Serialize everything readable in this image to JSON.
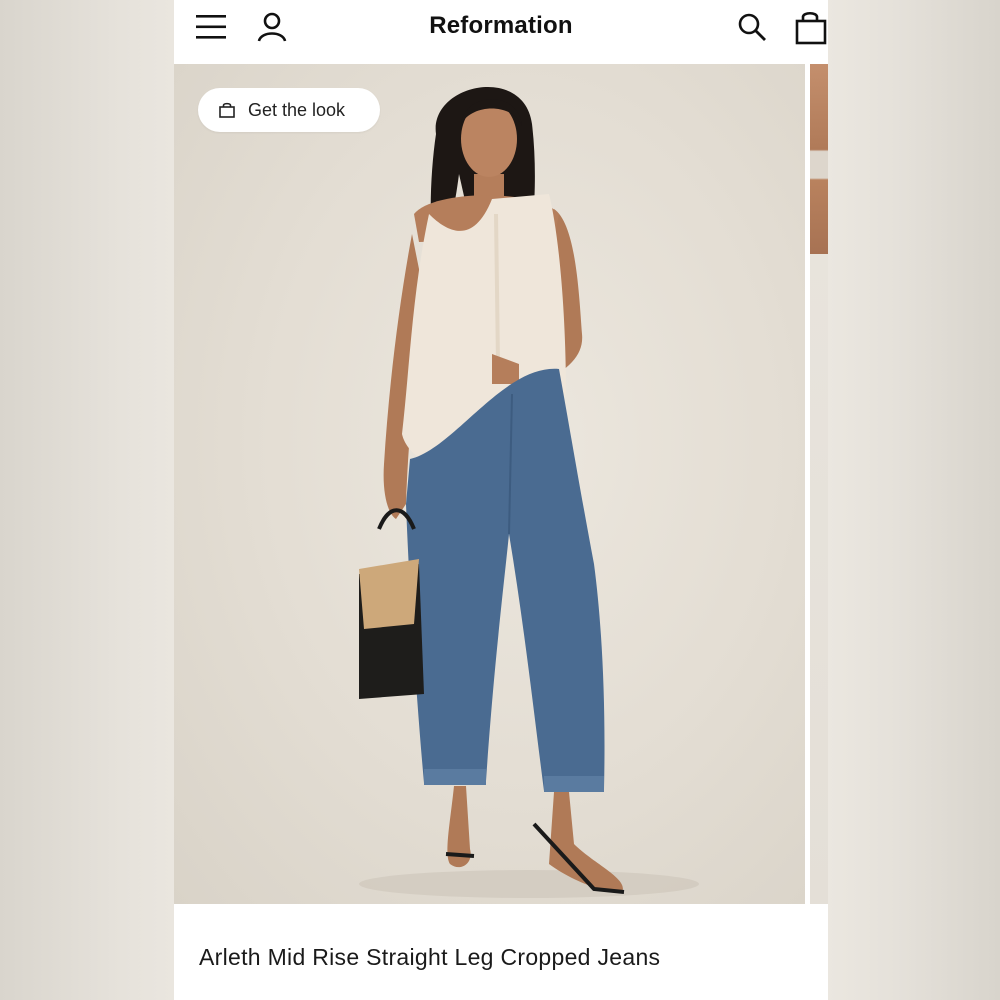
{
  "header": {
    "brand": "Reformation",
    "menu_icon": "hamburger-menu-icon",
    "account_icon": "user-icon",
    "search_icon": "search-icon",
    "bag_icon": "shopping-bag-icon"
  },
  "hero": {
    "get_the_look_label": "Get the look",
    "get_the_look_icon": "shopping-bag-icon"
  },
  "product": {
    "title": "Arleth Mid Rise Straight Leg Cropped Jeans"
  },
  "colors": {
    "background": "#e3ddd3",
    "text": "#111111",
    "denim": "#4a6b91",
    "top": "#efe6da"
  }
}
